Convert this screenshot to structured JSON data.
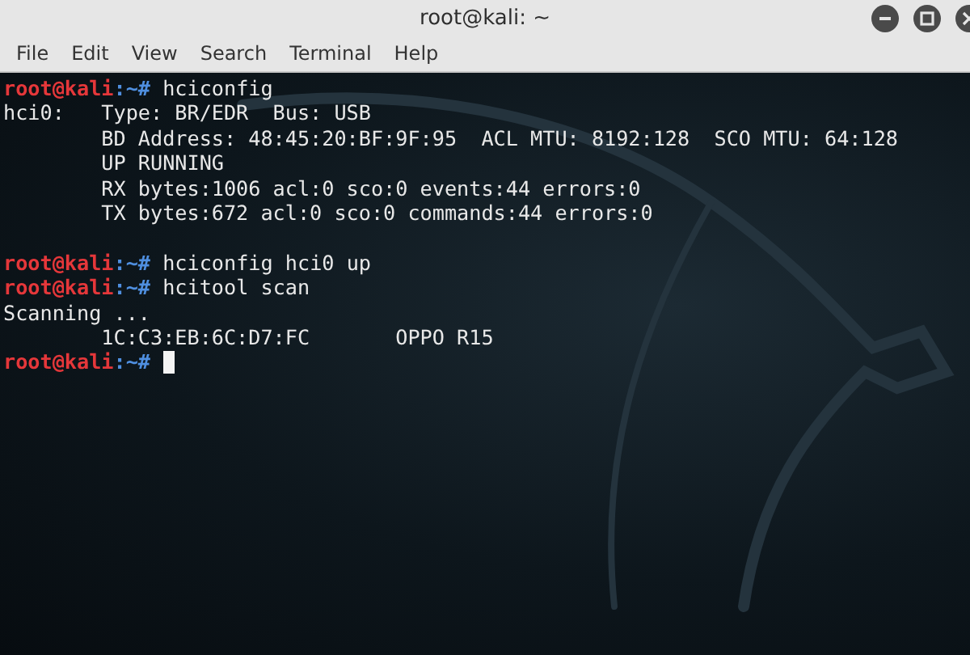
{
  "window": {
    "title": "root@kali: ~"
  },
  "menu": [
    "File",
    "Edit",
    "View",
    "Search",
    "Terminal",
    "Help"
  ],
  "terminal": {
    "lines": [
      {
        "kind": "prompt",
        "user": "root@kali",
        "path": ":~#",
        "command": "hciconfig"
      },
      {
        "kind": "output",
        "text": "hci0:   Type: BR/EDR  Bus: USB"
      },
      {
        "kind": "output",
        "text": "        BD Address: 48:45:20:BF:9F:95  ACL MTU: 8192:128  SCO MTU: 64:128"
      },
      {
        "kind": "output",
        "text": "        UP RUNNING"
      },
      {
        "kind": "output",
        "text": "        RX bytes:1006 acl:0 sco:0 events:44 errors:0"
      },
      {
        "kind": "output",
        "text": "        TX bytes:672 acl:0 sco:0 commands:44 errors:0"
      },
      {
        "kind": "blank"
      },
      {
        "kind": "prompt",
        "user": "root@kali",
        "path": ":~#",
        "command": "hciconfig hci0 up"
      },
      {
        "kind": "prompt",
        "user": "root@kali",
        "path": ":~#",
        "command": "hcitool scan"
      },
      {
        "kind": "output",
        "text": "Scanning ..."
      },
      {
        "kind": "output",
        "text": "        1C:C3:EB:6C:D7:FC       OPPO R15"
      },
      {
        "kind": "prompt",
        "user": "root@kali",
        "path": ":~#",
        "cursor": true
      }
    ]
  }
}
